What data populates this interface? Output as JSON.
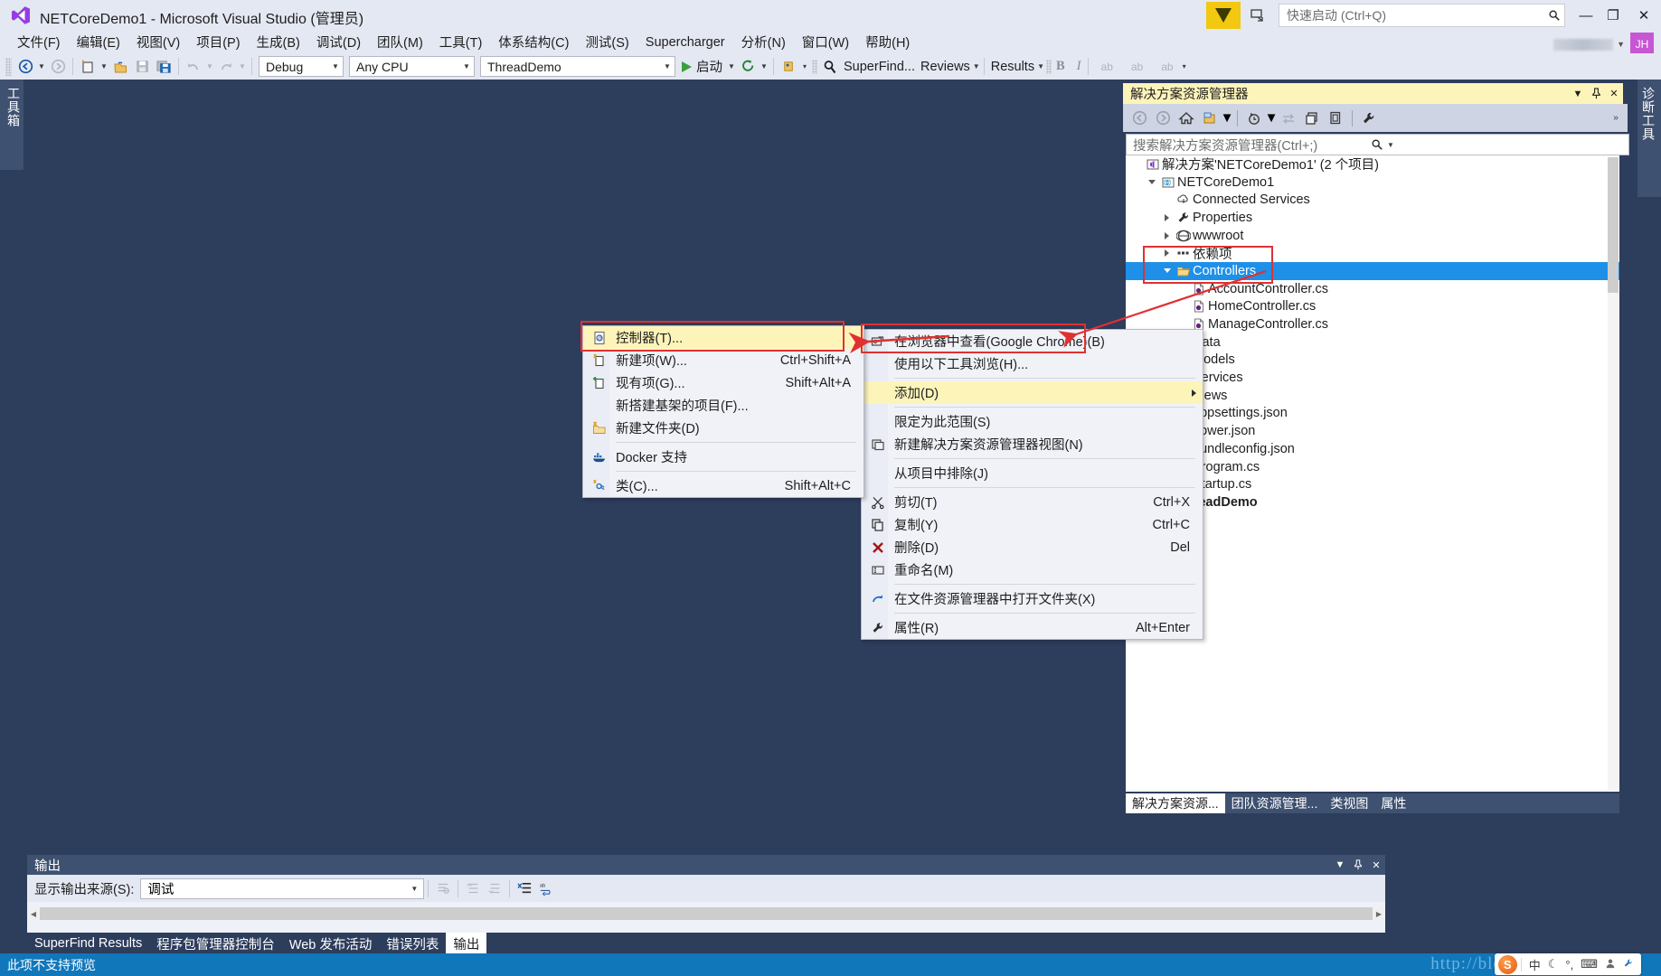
{
  "titlebar": {
    "title": "NETCoreDemo1 - Microsoft Visual Studio (管理员)",
    "quick_launch_placeholder": "快速启动 (Ctrl+Q)",
    "minimize": "—",
    "restore": "❐",
    "close": "✕",
    "avatar_initials": "JH"
  },
  "menubar": {
    "items": [
      "文件(F)",
      "编辑(E)",
      "视图(V)",
      "项目(P)",
      "生成(B)",
      "调试(D)",
      "团队(M)",
      "工具(T)",
      "体系结构(C)",
      "测试(S)",
      "Supercharger",
      "分析(N)",
      "窗口(W)",
      "帮助(H)"
    ]
  },
  "toolbar": {
    "config": "Debug",
    "platform": "Any CPU",
    "startup_project": "ThreadDemo",
    "start_label": "启动",
    "superfind_label": "SuperFind...",
    "reviews_label": "Reviews",
    "results_label": "Results",
    "bold_label": "B",
    "italic_label": "I",
    "ab1": "ab",
    "ab2": "ab",
    "ab3": "ab"
  },
  "docks": {
    "left_tab": "工具箱",
    "right_tab": "诊断工具"
  },
  "solution_explorer": {
    "title": "解决方案资源管理器",
    "search_placeholder": "搜索解决方案资源管理器(Ctrl+;)",
    "tree": [
      {
        "label": "解决方案'NETCoreDemo1' (2 个项目)",
        "indent": 0,
        "twisty": "none",
        "icon": "solution-icon",
        "selected": false,
        "bold": false
      },
      {
        "label": "NETCoreDemo1",
        "indent": 1,
        "twisty": "down",
        "icon": "web-project-icon",
        "selected": false,
        "bold": false
      },
      {
        "label": "Connected Services",
        "indent": 2,
        "twisty": "none",
        "icon": "connected-services-icon",
        "selected": false,
        "bold": false
      },
      {
        "label": "Properties",
        "indent": 2,
        "twisty": "right",
        "icon": "wrench-icon",
        "selected": false,
        "bold": false
      },
      {
        "label": "wwwroot",
        "indent": 2,
        "twisty": "right",
        "icon": "globe-icon",
        "selected": false,
        "bold": false
      },
      {
        "label": "依赖项",
        "indent": 2,
        "twisty": "right",
        "icon": "dependencies-icon",
        "selected": false,
        "bold": false
      },
      {
        "label": "Controllers",
        "indent": 2,
        "twisty": "down",
        "icon": "folder-open-icon",
        "selected": true,
        "bold": false
      },
      {
        "label": "AccountController.cs",
        "indent": 3,
        "twisty": "none",
        "icon": "csharp-file-icon",
        "selected": false,
        "bold": false
      },
      {
        "label": "HomeController.cs",
        "indent": 3,
        "twisty": "none",
        "icon": "csharp-file-icon",
        "selected": false,
        "bold": false
      },
      {
        "label": "ManageController.cs",
        "indent": 3,
        "twisty": "none",
        "icon": "csharp-file-icon",
        "selected": false,
        "bold": false
      },
      {
        "label": "Data",
        "indent": 2,
        "twisty": "right",
        "icon": "folder-icon",
        "selected": false,
        "bold": false
      },
      {
        "label": "Models",
        "indent": 2,
        "twisty": "right",
        "icon": "folder-icon",
        "selected": false,
        "bold": false
      },
      {
        "label": "Services",
        "indent": 2,
        "twisty": "right",
        "icon": "folder-icon",
        "selected": false,
        "bold": false
      },
      {
        "label": "Views",
        "indent": 2,
        "twisty": "right",
        "icon": "folder-icon",
        "selected": false,
        "bold": false
      },
      {
        "label": "appsettings.json",
        "indent": 2,
        "twisty": "right",
        "icon": "json-file-icon",
        "selected": false,
        "bold": false
      },
      {
        "label": "bower.json",
        "indent": 2,
        "twisty": "none",
        "icon": "json-file-icon",
        "selected": false,
        "bold": false
      },
      {
        "label": "bundleconfig.json",
        "indent": 2,
        "twisty": "none",
        "icon": "json-file-icon",
        "selected": false,
        "bold": false
      },
      {
        "label": "Program.cs",
        "indent": 2,
        "twisty": "none",
        "icon": "csharp-file-icon",
        "selected": false,
        "bold": false
      },
      {
        "label": "Startup.cs",
        "indent": 2,
        "twisty": "none",
        "icon": "csharp-file-icon",
        "selected": false,
        "bold": false
      },
      {
        "label": "ThreadDemo",
        "indent": 1,
        "twisty": "right",
        "icon": "csproject-icon",
        "selected": false,
        "bold": true
      }
    ],
    "bottom_tabs": [
      {
        "label": "解决方案资源...",
        "active": true
      },
      {
        "label": "团队资源管理...",
        "active": false
      },
      {
        "label": "类视图",
        "active": false
      },
      {
        "label": "属性",
        "active": false
      }
    ]
  },
  "context_menu": {
    "items": [
      {
        "label": "在浏览器中查看(Google Chrome)(B)",
        "key": "",
        "icon": "browser-icon",
        "highlight": false,
        "submenu": false,
        "sep_after": false
      },
      {
        "label": "使用以下工具浏览(H)...",
        "key": "",
        "icon": "",
        "highlight": false,
        "submenu": false,
        "sep_after": true
      },
      {
        "label": "添加(D)",
        "key": "",
        "icon": "",
        "highlight": true,
        "submenu": true,
        "sep_after": true
      },
      {
        "label": "限定为此范围(S)",
        "key": "",
        "icon": "",
        "highlight": false,
        "submenu": false,
        "sep_after": false
      },
      {
        "label": "新建解决方案资源管理器视图(N)",
        "key": "",
        "icon": "new-window-icon",
        "highlight": false,
        "submenu": false,
        "sep_after": true
      },
      {
        "label": "从项目中排除(J)",
        "key": "",
        "icon": "",
        "highlight": false,
        "submenu": false,
        "sep_after": true
      },
      {
        "label": "剪切(T)",
        "key": "Ctrl+X",
        "icon": "scissors-icon",
        "highlight": false,
        "submenu": false,
        "sep_after": false
      },
      {
        "label": "复制(Y)",
        "key": "Ctrl+C",
        "icon": "copy-icon",
        "highlight": false,
        "submenu": false,
        "sep_after": false
      },
      {
        "label": "删除(D)",
        "key": "Del",
        "icon": "delete-x-icon",
        "highlight": false,
        "submenu": false,
        "sep_after": false
      },
      {
        "label": "重命名(M)",
        "key": "",
        "icon": "rename-icon",
        "highlight": false,
        "submenu": false,
        "sep_after": true
      },
      {
        "label": "在文件资源管理器中打开文件夹(X)",
        "key": "",
        "icon": "open-folder-arrow-icon",
        "highlight": false,
        "submenu": false,
        "sep_after": true
      },
      {
        "label": "属性(R)",
        "key": "Alt+Enter",
        "icon": "wrench-icon",
        "highlight": false,
        "submenu": false,
        "sep_after": false
      }
    ]
  },
  "submenu": {
    "items": [
      {
        "label": "控制器(T)...",
        "key": "",
        "icon": "controller-icon",
        "highlight": true,
        "sep_after": false
      },
      {
        "label": "新建项(W)...",
        "key": "Ctrl+Shift+A",
        "icon": "new-item-icon",
        "highlight": false,
        "sep_after": false
      },
      {
        "label": "现有项(G)...",
        "key": "Shift+Alt+A",
        "icon": "existing-item-icon",
        "highlight": false,
        "sep_after": false
      },
      {
        "label": "新搭建基架的项目(F)...",
        "key": "",
        "icon": "",
        "highlight": false,
        "sep_after": false
      },
      {
        "label": "新建文件夹(D)",
        "key": "",
        "icon": "new-folder-icon",
        "highlight": false,
        "sep_after": true
      },
      {
        "label": "Docker 支持",
        "key": "",
        "icon": "docker-icon",
        "highlight": false,
        "sep_after": true
      },
      {
        "label": "类(C)...",
        "key": "Shift+Alt+C",
        "icon": "class-icon",
        "highlight": false,
        "sep_after": false
      }
    ]
  },
  "output_panel": {
    "title": "输出",
    "source_label": "显示输出来源(S):",
    "source_value": "调试",
    "tabs": [
      {
        "label": "SuperFind Results",
        "active": false
      },
      {
        "label": "程序包管理器控制台",
        "active": false
      },
      {
        "label": "Web 发布活动",
        "active": false
      },
      {
        "label": "错误列表",
        "active": false
      },
      {
        "label": "输出",
        "active": true
      }
    ]
  },
  "statusbar": {
    "text": "此项不支持预览",
    "watermark": "http://blog.csdn.net/real_jh",
    "ime": {
      "logo": "S",
      "mode": "中",
      "items": [
        "☾",
        "°,",
        "⌨",
        "👤",
        "🔧"
      ]
    }
  },
  "colors": {
    "title_bg": "#e4e8f2",
    "editor_bg": "#2d3d5c",
    "accent_yellow": "#f2c811",
    "selection_blue": "#1e90e8",
    "status_blue": "#1177bb",
    "menu_highlight": "#fdf4ba",
    "anno_red": "#e03131"
  }
}
